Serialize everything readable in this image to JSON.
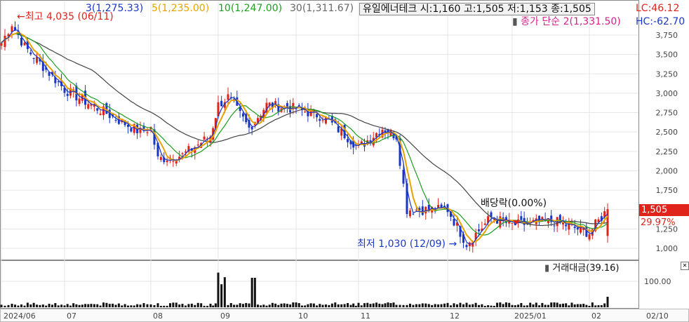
{
  "legend": {
    "ma3": "3(1,275.33)",
    "ma5": "5(1,235.00)",
    "ma10": "10(1,247.00)",
    "ma30": "30(1,311.67)",
    "stock_info": "유일에너테크 시:1,160 고:1,505 저:1,153 종:1,505",
    "lc": "LC:46.12",
    "hc": "HC:-62.70",
    "close_simple": "종가 단순 2(1,331.50)"
  },
  "colors": {
    "up": "#e0231b",
    "down": "#1a37c4",
    "ma3": "#1a37c4",
    "ma5": "#e6a300",
    "ma10": "#1e9d1e",
    "ma30": "#444444",
    "pink": "#d4218c"
  },
  "annotations": {
    "high": "←최고 4,035 (06/11)",
    "low": "최저 1,030 (12/09) →",
    "ex_dividend": "배당락(0.00%)"
  },
  "price_axis": [
    "3,750",
    "3,500",
    "3,250",
    "3,000",
    "2,750",
    "2,500",
    "2,250",
    "2,000",
    "1,750",
    "1,500",
    "1,250",
    "1,000"
  ],
  "current_price_badge": "1,505",
  "change_pct": "29.97%",
  "volume_panel": {
    "title": "거래대금(39.16)",
    "axis_label": "100.00"
  },
  "date_axis": [
    "2024/06",
    "07",
    "08",
    "09",
    "10",
    "11",
    "12",
    "2025/01",
    "02",
    "02/10"
  ],
  "chart_data": {
    "type": "candlestick",
    "series": [
      {
        "name": "3",
        "values": []
      },
      {
        "name": "5",
        "values": []
      },
      {
        "name": "10",
        "values": []
      },
      {
        "name": "30",
        "values": []
      }
    ],
    "close_trend": [
      {
        "x": "2024/06",
        "y": 3650
      },
      {
        "x": "06/11",
        "y": 3900
      },
      {
        "x": "06/20",
        "y": 3600
      },
      {
        "x": "07",
        "y": 3050
      },
      {
        "x": "07/15",
        "y": 2850
      },
      {
        "x": "07/31",
        "y": 2500
      },
      {
        "x": "08",
        "y": 2550
      },
      {
        "x": "08/05",
        "y": 2150
      },
      {
        "x": "08/15",
        "y": 2200
      },
      {
        "x": "08/26",
        "y": 2450
      },
      {
        "x": "09",
        "y": 2850
      },
      {
        "x": "09/05",
        "y": 2950
      },
      {
        "x": "09/15",
        "y": 2550
      },
      {
        "x": "09/25",
        "y": 2850
      },
      {
        "x": "10",
        "y": 2800
      },
      {
        "x": "10/15",
        "y": 2700
      },
      {
        "x": "10/31",
        "y": 2400
      },
      {
        "x": "11",
        "y": 2300
      },
      {
        "x": "11/10",
        "y": 2550
      },
      {
        "x": "11/15",
        "y": 2450
      },
      {
        "x": "11/20",
        "y": 1500
      },
      {
        "x": "12",
        "y": 1500
      },
      {
        "x": "12/09",
        "y": 1060
      },
      {
        "x": "12/20",
        "y": 1400
      },
      {
        "x": "2025/01",
        "y": 1300
      },
      {
        "x": "01/15",
        "y": 1350
      },
      {
        "x": "02",
        "y": 1200
      },
      {
        "x": "02/10",
        "y": 1505
      }
    ],
    "ylim": [
      900,
      3950
    ],
    "ylabel": "",
    "xlabel": ""
  }
}
